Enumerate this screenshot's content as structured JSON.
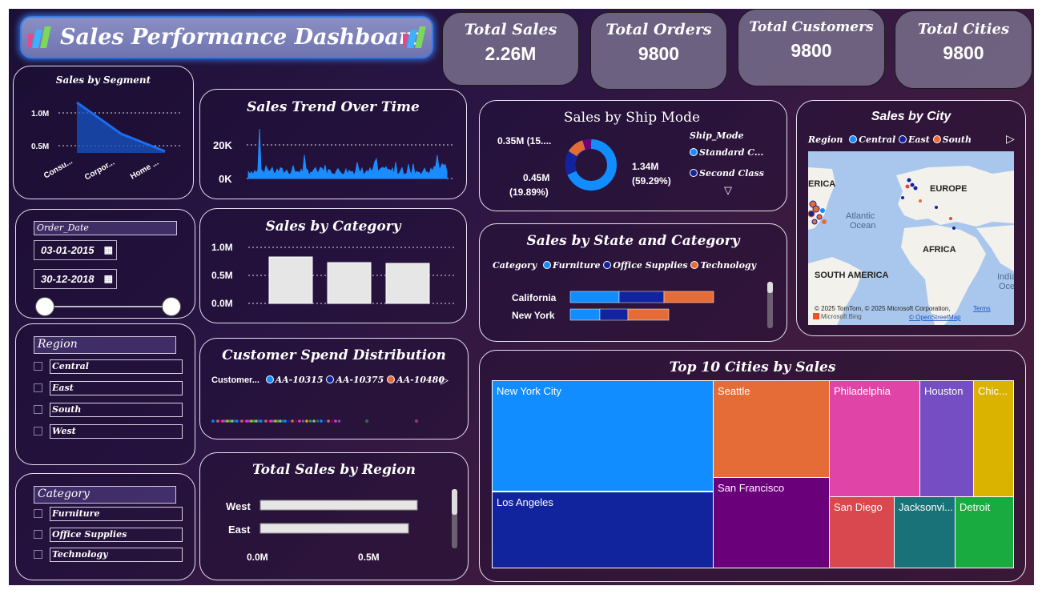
{
  "dashboard": {
    "title": "Sales Performance Dashboard",
    "kpis": [
      {
        "label": "Total Sales",
        "value": "2.26M"
      },
      {
        "label": "Total Orders",
        "value": "9800"
      },
      {
        "label": "Total Customers",
        "value": "9800"
      },
      {
        "label": "Total Cities",
        "value": "9800"
      }
    ]
  },
  "segment": {
    "title": "Sales by Segment",
    "yticks": [
      "1.0M",
      "0.5M"
    ],
    "categories": [
      "Consu...",
      "Corpor...",
      "Home ..."
    ]
  },
  "trend": {
    "title": "Sales Trend Over Time",
    "yticks": [
      "20K",
      "0K"
    ]
  },
  "category_chart": {
    "title": "Sales by Category",
    "yticks": [
      "1.0M",
      "0.5M",
      "0.0M"
    ]
  },
  "date_slicer": {
    "header": "Order_Date",
    "start": "03-01-2015",
    "end": "30-12-2018"
  },
  "region_slicer": {
    "header": "Region",
    "items": [
      "Central",
      "East",
      "South",
      "West"
    ]
  },
  "category_slicer": {
    "header": "Category",
    "items": [
      "Furniture",
      "Office Supplies",
      "Technology"
    ]
  },
  "customer_spend": {
    "title": "Customer Spend Distribution",
    "legend_title": "Customer...",
    "legend": [
      {
        "name": "AA-10315",
        "color": "#118dff"
      },
      {
        "name": "AA-10375",
        "color": "#12239e"
      },
      {
        "name": "AA-10480",
        "color": "#e66c37"
      }
    ]
  },
  "region_sales": {
    "title": "Total Sales by Region",
    "labels": [
      "West",
      "East"
    ],
    "xticks": [
      "0.0M",
      "0.5M"
    ]
  },
  "ship_mode": {
    "title": "Sales by Ship Mode",
    "legend_title": "Ship_Mode",
    "legend": [
      {
        "name": "Standard C...",
        "color": "#118dff"
      },
      {
        "name": "Second Class",
        "color": "#12239e"
      }
    ],
    "labels": {
      "top": "0.35M (15....",
      "left_value": "0.45M",
      "left_pct": "(19.89%)",
      "right_value": "1.34M",
      "right_pct": "(59.29%)"
    }
  },
  "state_category": {
    "title": "Sales by State and Category",
    "legend_title": "Category",
    "legend": [
      {
        "name": "Furniture",
        "color": "#118dff"
      },
      {
        "name": "Office Supplies",
        "color": "#12239e"
      },
      {
        "name": "Technology",
        "color": "#e66c37"
      }
    ],
    "states": [
      "California",
      "New York"
    ]
  },
  "city_map": {
    "title": "Sales by City",
    "legend_title": "Region",
    "legend": [
      {
        "name": "Central",
        "color": "#118dff"
      },
      {
        "name": "East",
        "color": "#12239e"
      },
      {
        "name": "South",
        "color": "#e66c37"
      }
    ],
    "map_labels": [
      "ERICA",
      "EUROPE",
      "Atlantic",
      "Ocean",
      "AFRICA",
      "SOUTH AMERICA",
      "Indian",
      "Ocea"
    ],
    "attribution": "© 2025 TomTom, © 2025 Microsoft Corporation,",
    "terms": "Terms",
    "osm": "© OpenStreetMap",
    "bing": "Microsoft Bing"
  },
  "top_cities": {
    "title": "Top 10 Cities by Sales",
    "cities": [
      {
        "name": "New York City",
        "color": "#118dff"
      },
      {
        "name": "Los Angeles",
        "color": "#12239e"
      },
      {
        "name": "Seattle",
        "color": "#e66c37"
      },
      {
        "name": "San Francisco",
        "color": "#6b007b"
      },
      {
        "name": "Philadelphia",
        "color": "#e044a7"
      },
      {
        "name": "San Diego",
        "color": "#d9474f"
      },
      {
        "name": "Houston",
        "color": "#744ec2"
      },
      {
        "name": "Jacksonvi...",
        "color": "#197278"
      },
      {
        "name": "Chic...",
        "color": "#d9b300"
      },
      {
        "name": "Detroit",
        "color": "#1aab40"
      }
    ]
  }
}
